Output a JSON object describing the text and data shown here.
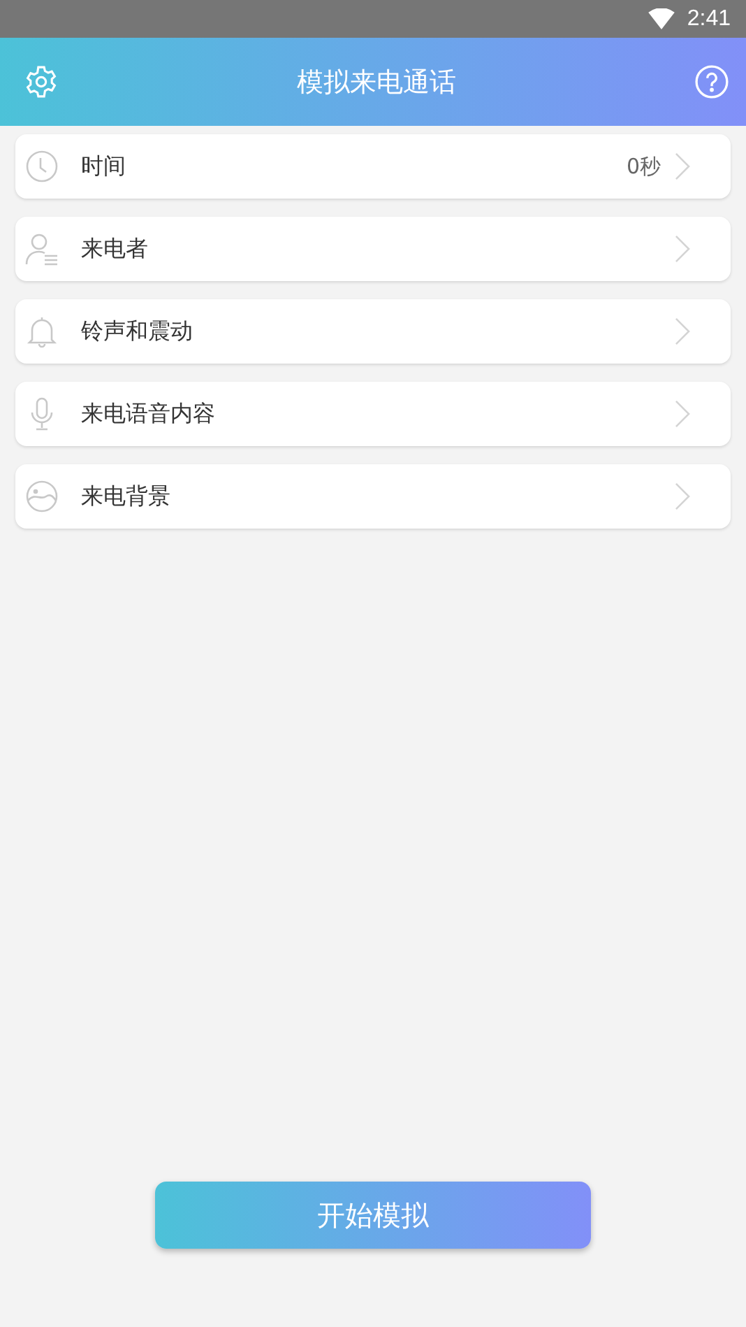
{
  "status_bar": {
    "time": "2:41"
  },
  "header": {
    "title": "模拟来电通话"
  },
  "items": [
    {
      "kind": "clock",
      "label": "时间",
      "value": "0秒"
    },
    {
      "kind": "person",
      "label": "来电者"
    },
    {
      "kind": "bell",
      "label": "铃声和震动"
    },
    {
      "kind": "mic",
      "label": "来电语音内容"
    },
    {
      "kind": "image",
      "label": "来电背景"
    }
  ],
  "start_button": {
    "label": "开始模拟"
  }
}
